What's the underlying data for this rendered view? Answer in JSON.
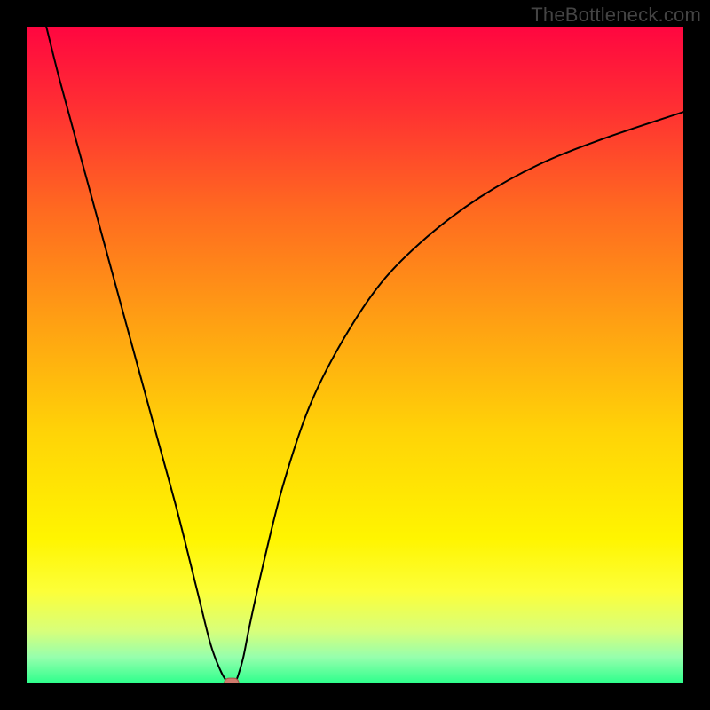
{
  "watermark": "TheBottleneck.com",
  "chart_data": {
    "type": "line",
    "title": "",
    "xlabel": "",
    "ylabel": "",
    "xlim": [
      0,
      100
    ],
    "ylim": [
      0,
      100
    ],
    "grid": false,
    "legend": false,
    "background": {
      "type": "vertical-gradient",
      "stops": [
        {
          "pos": 0.0,
          "color": "#ff0640"
        },
        {
          "pos": 0.12,
          "color": "#ff2e33"
        },
        {
          "pos": 0.28,
          "color": "#ff6a20"
        },
        {
          "pos": 0.45,
          "color": "#ffa013"
        },
        {
          "pos": 0.62,
          "color": "#ffd407"
        },
        {
          "pos": 0.78,
          "color": "#fff500"
        },
        {
          "pos": 0.86,
          "color": "#fcff39"
        },
        {
          "pos": 0.92,
          "color": "#d8ff7a"
        },
        {
          "pos": 0.96,
          "color": "#96ffad"
        },
        {
          "pos": 1.0,
          "color": "#2dff8c"
        }
      ]
    },
    "series": [
      {
        "name": "curve",
        "stroke": "#000000",
        "stroke_width": 2,
        "x": [
          3,
          5,
          8,
          11,
          14,
          17,
          20,
          23,
          26,
          28,
          29.5,
          30.5,
          31.2,
          31.8,
          32.2,
          33,
          34,
          36,
          39,
          43,
          48,
          54,
          61,
          69,
          78,
          88,
          100
        ],
        "y": [
          100,
          92,
          81,
          70,
          59,
          48,
          37,
          26,
          14,
          6,
          2,
          0.3,
          0,
          0.3,
          1.2,
          4,
          9,
          18,
          30,
          42,
          52,
          61,
          68,
          74,
          79,
          83,
          87
        ]
      }
    ],
    "markers": [
      {
        "name": "min-point",
        "x": 31.2,
        "y": 0,
        "shape": "rounded-rect",
        "width": 2.2,
        "height": 1.6,
        "fill": "#cf7a6d",
        "stroke": "#a35348"
      }
    ]
  }
}
